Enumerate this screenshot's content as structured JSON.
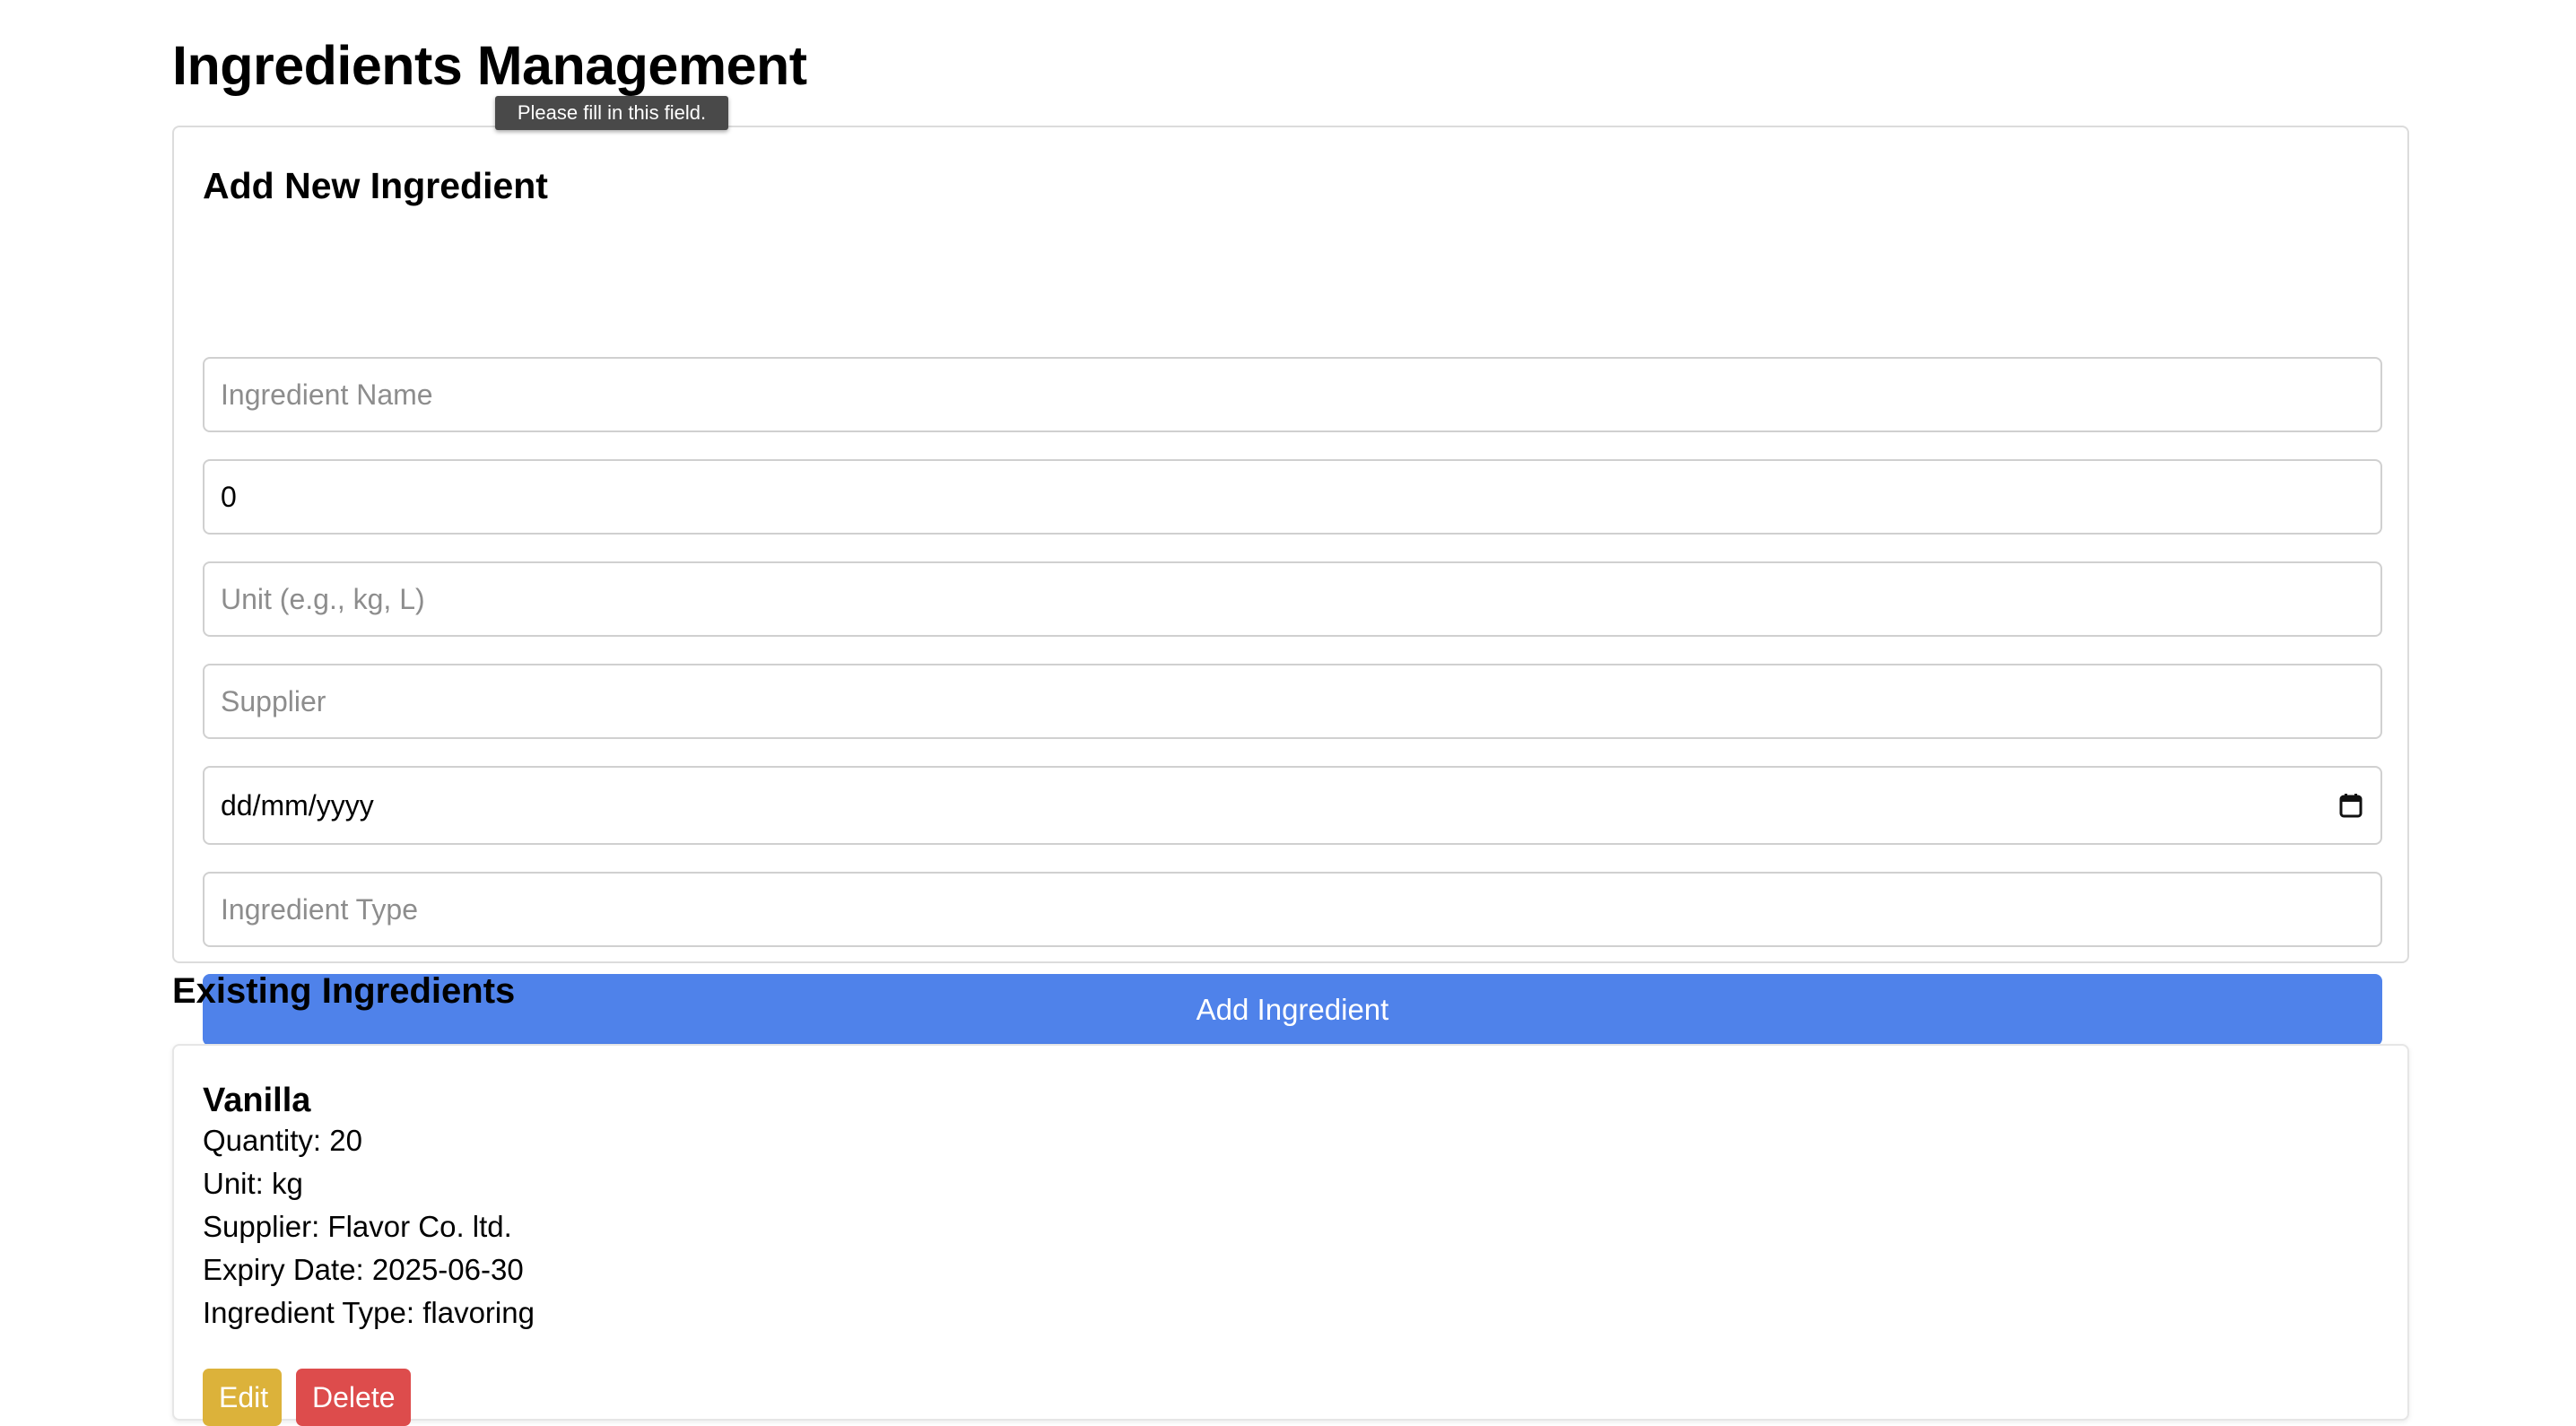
{
  "page": {
    "title": "Ingredients Management"
  },
  "tooltip": {
    "text": "Please fill in this field."
  },
  "form": {
    "title": "Add New Ingredient",
    "name_placeholder": "Ingredient Name",
    "quantity_value": "0",
    "unit_placeholder": "Unit (e.g., kg, L)",
    "supplier_placeholder": "Supplier",
    "date_value": "dd/mm/yyyy",
    "type_placeholder": "Ingredient Type",
    "submit_label": "Add Ingredient"
  },
  "list": {
    "title": "Existing Ingredients",
    "items": [
      {
        "name": "Vanilla",
        "quantity": "Quantity: 20",
        "unit": "Unit: kg",
        "supplier": "Supplier: Flavor Co. ltd.",
        "expiry": "Expiry Date: 2025-06-30",
        "type": "Ingredient Type: flavoring",
        "edit_label": "Edit",
        "delete_label": "Delete"
      }
    ]
  },
  "colors": {
    "primary": "#4f82ea",
    "edit": "#dcb23a",
    "delete": "#dd4c4c"
  },
  "icons": {
    "date_picker": "calendar-icon"
  }
}
